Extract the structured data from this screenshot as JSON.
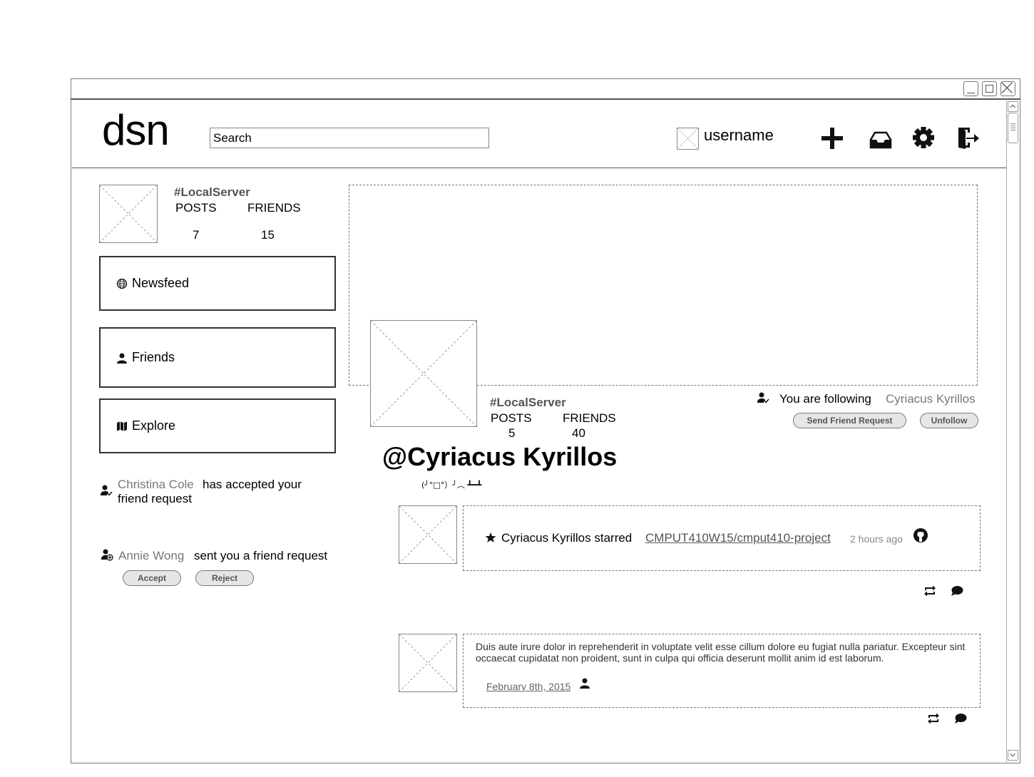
{
  "header": {
    "logo": "dsn",
    "search": {
      "placeholder": "Search",
      "value": ""
    },
    "username": "username",
    "icons": [
      "add-icon",
      "inbox-icon",
      "gear-icon",
      "logout-icon"
    ]
  },
  "sidebar": {
    "server": "#LocalServer",
    "posts_label": "POSTS",
    "friends_label": "FRIENDS",
    "posts_count": "7",
    "friends_count": "15",
    "nav": [
      {
        "label": "Newsfeed",
        "icon": "globe-icon"
      },
      {
        "label": "Friends",
        "icon": "user-icon"
      },
      {
        "label": "Explore",
        "icon": "map-icon"
      }
    ],
    "notifications": [
      {
        "name": "Christina Cole",
        "text_line1": "has accepted your",
        "text_line2": "friend request",
        "icon": "user-check-icon"
      },
      {
        "name": "Annie Wong",
        "text": "sent you a friend request",
        "icon": "user-add-icon",
        "accept_label": "Accept",
        "reject_label": "Reject"
      }
    ]
  },
  "profile": {
    "server": "#LocalServer",
    "posts_label": "POSTS",
    "friends_label": "FRIENDS",
    "posts_count": "5",
    "friends_count": "40",
    "name": "@Cyriacus Kyrillos",
    "tagline": "(╯°□°）╯︵ ┻━┻",
    "following_text": "You are following",
    "following_name": "Cyriacus Kyrillos",
    "send_request_label": "Send Friend Request",
    "unfollow_label": "Unfollow"
  },
  "feed": [
    {
      "text": "Cyriacus Kyrillos starred",
      "repo": "CMPUT410W15/cmput410-project",
      "time": "2 hours ago"
    },
    {
      "text": "Duis aute irure dolor in reprehenderit in voluptate velit esse cillum dolore eu fugiat nulla pariatur. Excepteur sint occaecat cupidatat non proident, sunt in culpa qui officia deserunt mollit anim id est laborum.",
      "date": "February 8th, 2015"
    }
  ]
}
